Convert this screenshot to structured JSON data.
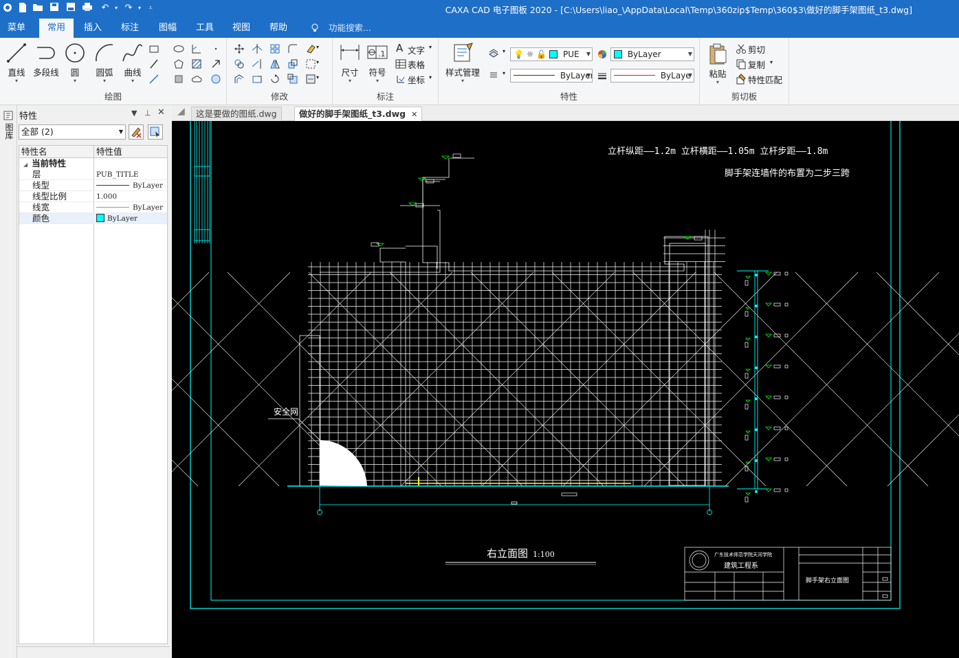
{
  "app": {
    "title": "CAXA CAD 电子图板 2020 - [C:\\Users\\liao_\\AppData\\Local\\Temp\\360zip$Temp\\360$3\\做好的脚手架图纸_t3.dwg]",
    "quick_access_icons": [
      "app-menu-icon",
      "new-icon",
      "open-icon",
      "save-icon",
      "save-as-icon",
      "print-icon",
      "undo-icon",
      "redo-icon",
      "customize-icon"
    ]
  },
  "ribbon_tabs": [
    "菜单",
    "常用",
    "插入",
    "标注",
    "图幅",
    "工具",
    "视图",
    "帮助"
  ],
  "active_tab": "常用",
  "search_placeholder": "功能搜索...",
  "groups": {
    "draw": {
      "label": "绘图",
      "buttons": [
        "直线",
        "多段线",
        "圆",
        "圆弧",
        "曲线"
      ]
    },
    "modify": {
      "label": "修改"
    },
    "annotate": {
      "label": "标注",
      "buttons": [
        "尺寸",
        "符号"
      ],
      "small": [
        "文字",
        "表格",
        "坐标"
      ]
    },
    "properties": {
      "label": "特性",
      "style_button": "样式管理",
      "layer_combo": "PUE",
      "color_combo": "ByLayer",
      "linetype_combo": "ByLayer",
      "lineweight_combo": "ByLaye"
    },
    "clipboard": {
      "label": "剪切板",
      "paste": "粘贴",
      "small": [
        "剪切",
        "复制",
        "特性匹配"
      ]
    }
  },
  "left_strip_label": "图库",
  "properties_panel": {
    "title": "特性",
    "selection": "全部 (2)",
    "col_name": "特性名",
    "col_value": "特性值",
    "category": "当前特性",
    "rows": [
      {
        "name": "层",
        "value": "PUB_TITLE"
      },
      {
        "name": "线型",
        "value": "ByLayer"
      },
      {
        "name": "线型比例",
        "value": "1.000"
      },
      {
        "name": "线宽",
        "value": "ByLayer"
      },
      {
        "name": "颜色",
        "value": "ByLayer"
      }
    ]
  },
  "doc_tabs": [
    {
      "label": "这是要做的图纸.dwg",
      "active": false
    },
    {
      "label": "做好的脚手架图纸_t3.dwg",
      "active": true
    }
  ],
  "drawing": {
    "note_line1": "立杆纵距——1.2m  立杆横距——1.05m  立杆步距——1.8m",
    "note_line2": "脚手架连墙件的布置为二步三跨",
    "safety_net_label": "安全网",
    "view_title": "右立面图",
    "view_scale": "1:100",
    "titleblock": {
      "school": "广东技术师范学院天河学院",
      "dept": "建筑工程系",
      "drawing_name": "脚手架右立面图"
    }
  },
  "colors": {
    "ribbon_blue": "#1e6fc8",
    "canvas_bg": "#000000",
    "frame_cyan": "#00ffff",
    "scaffold_white": "#ffffff",
    "marker_green": "#00ff00",
    "ground_yellow": "#ffff00"
  }
}
